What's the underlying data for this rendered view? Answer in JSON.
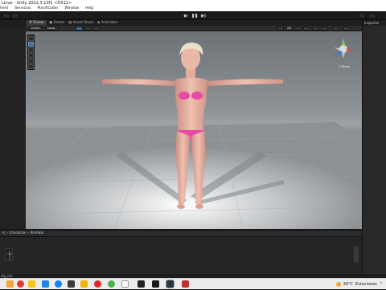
{
  "window": {
    "title": "Linux - Unity 2022.3.13f1 <DX11>"
  },
  "menu": [
    "hent",
    "Servicios",
    "Plasificador",
    "Window",
    "Help"
  ],
  "tabs": [
    {
      "label": "Scene",
      "active": true
    },
    {
      "label": "Game",
      "active": false
    },
    {
      "label": "Asset Store",
      "active": false
    },
    {
      "label": "Animator",
      "active": false
    }
  ],
  "inspector": {
    "tab_label": "Inspector"
  },
  "scene_toolbar": {
    "shading": "Center",
    "pivot": "Local",
    "view_label": "2D",
    "gizmo_persp": "< Persp"
  },
  "bottom_panel": {
    "breadcrumb_prefix": "lc",
    "breadcrumb_sep": "›",
    "breadcrumb_mid": "character",
    "breadcrumb_sep2": "›",
    "breadcrumb_last": "Prefabs"
  },
  "status": {
    "text": "ety_list"
  },
  "taskbar": {
    "weather": "30°C",
    "location": "Estaciones"
  },
  "colors": {
    "accent": "#3f6fa8",
    "bikini": "#e44aa6"
  }
}
